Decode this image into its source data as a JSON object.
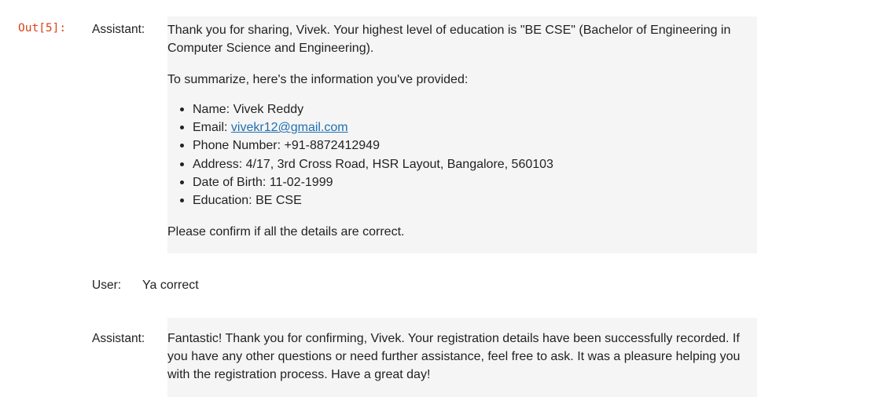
{
  "cell": {
    "prompt": "Out[5]:"
  },
  "messages": [
    {
      "role": "Assistant:",
      "paragraph_1": "Thank you for sharing, Vivek. Your highest level of education is \"BE CSE\" (Bachelor of Engineering in Computer Science and Engineering).",
      "paragraph_2": "To summarize, here's the information you've provided:",
      "details": [
        {
          "label": "Name: ",
          "value": "Vivek Reddy"
        },
        {
          "label": "Email: ",
          "value": "vivekr12@gmail.com",
          "is_link": true
        },
        {
          "label": "Phone Number: ",
          "value": "+91-8872412949"
        },
        {
          "label": "Address: ",
          "value": "4/17, 3rd Cross Road, HSR Layout, Bangalore, 560103"
        },
        {
          "label": "Date of Birth: ",
          "value": "11-02-1999"
        },
        {
          "label": "Education: ",
          "value": "BE CSE"
        }
      ],
      "paragraph_3": "Please confirm if all the details are correct."
    },
    {
      "role": "User:",
      "text": "Ya correct"
    },
    {
      "role": "Assistant:",
      "text": "Fantastic! Thank you for confirming, Vivek. Your registration details have been successfully recorded. If you have any other questions or need further assistance, feel free to ask. It was a pleasure helping you with the registration process. Have a great day!"
    }
  ],
  "colors": {
    "prompt": "#d84315",
    "bubble_background": "#f5f5f5",
    "link": "#1f6fb2",
    "text": "#222222"
  }
}
